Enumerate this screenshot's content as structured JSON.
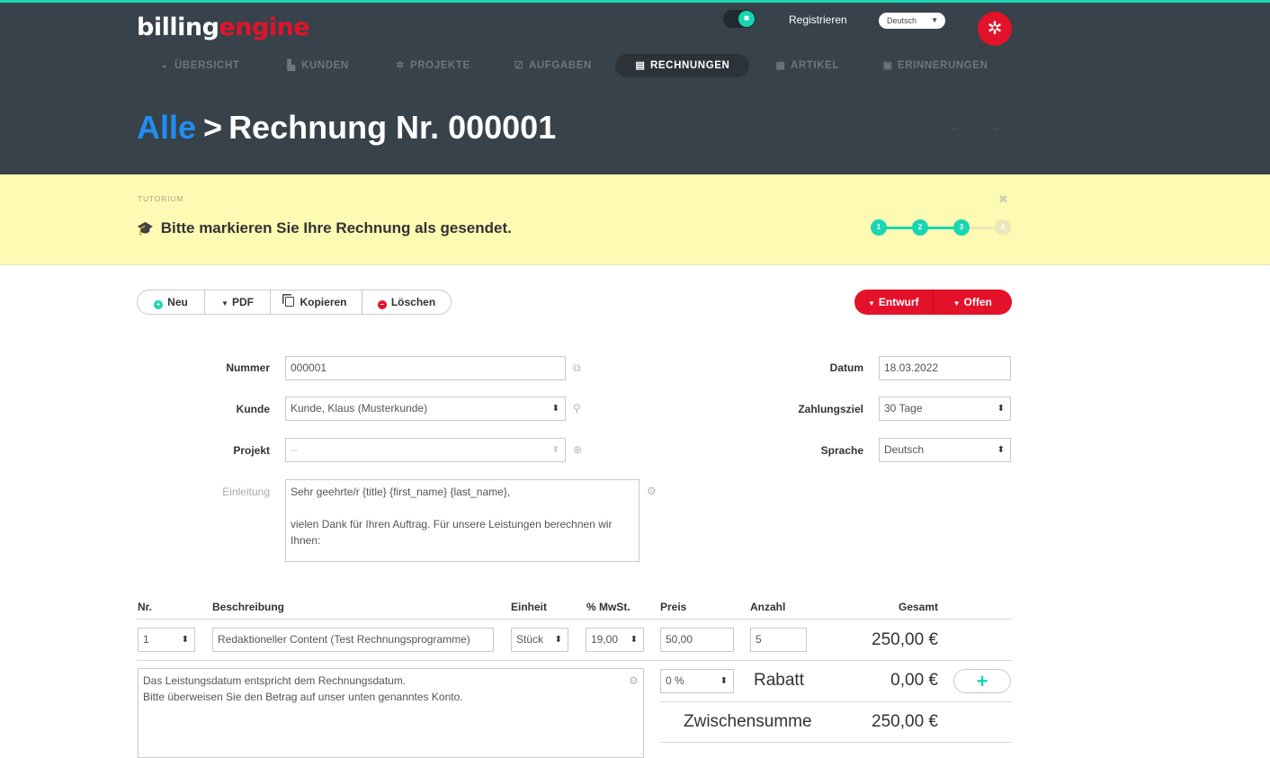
{
  "brand": {
    "logo_part1": "billing",
    "logo_part2": "engine"
  },
  "topbar": {
    "register": "Registrieren",
    "language": "Deutsch"
  },
  "nav": [
    {
      "label": "ÜBERSICHT",
      "icon": "dashboard-icon",
      "glyph": "◒"
    },
    {
      "label": "KUNDEN",
      "icon": "customers-icon",
      "glyph": "▙"
    },
    {
      "label": "PROJEKTE",
      "icon": "gear-icon",
      "glyph": "✲"
    },
    {
      "label": "AUFGABEN",
      "icon": "checkbox-icon",
      "glyph": "☑"
    },
    {
      "label": "RECHNUNGEN",
      "icon": "invoice-icon",
      "glyph": "▤"
    },
    {
      "label": "ARTIKEL",
      "icon": "article-icon",
      "glyph": "▦"
    },
    {
      "label": "ERINNERUNGEN",
      "icon": "calendar-icon",
      "glyph": "▣"
    }
  ],
  "page": {
    "crumb": "Alle",
    "title": "Rechnung Nr. 000001"
  },
  "tutorial": {
    "label": "TUTORIUM",
    "text": "Bitte markieren Sie Ihre Rechnung als gesendet.",
    "steps": [
      "1",
      "2",
      "3",
      "4"
    ],
    "current_step": 3
  },
  "toolbar": {
    "new": "Neu",
    "pdf": "PDF",
    "copy": "Kopieren",
    "delete": "Löschen"
  },
  "status": {
    "draft": "Entwurf",
    "open": "Offen"
  },
  "form": {
    "number_label": "Nummer",
    "number": "000001",
    "customer_label": "Kunde",
    "customer": "Kunde, Klaus (Musterkunde)",
    "project_label": "Projekt",
    "project": "--",
    "intro_label": "Einleitung",
    "intro_line1": "Sehr geehrte/r {title} {first_name} {last_name},",
    "intro_line2": "vielen Dank für Ihren Auftrag. Für unsere Leistungen berechnen wir",
    "intro_line3": "Ihnen:",
    "date_label": "Datum",
    "date": "18.03.2022",
    "payment_label": "Zahlungsziel",
    "payment": "30 Tage",
    "language_label": "Sprache",
    "language": "Deutsch"
  },
  "table": {
    "headers": {
      "nr": "Nr.",
      "desc": "Beschreibung",
      "unit": "Einheit",
      "vat": "% MwSt.",
      "price": "Preis",
      "qty": "Anzahl",
      "total": "Gesamt"
    },
    "rows": [
      {
        "nr": "1",
        "desc": "Redaktioneller Content (Test Rechnungsprogramme)",
        "unit": "Stück",
        "vat": "19,00",
        "price": "50,00",
        "qty": "5",
        "total": "250,00 €"
      }
    ]
  },
  "footer": {
    "note_line1": "Das Leistungsdatum entspricht dem Rechnungsdatum.",
    "note_line2": "Bitte überweisen Sie den Betrag auf unser unten genanntes Konto.",
    "discount": "0 %",
    "discount_label": "Rabatt",
    "discount_value": "0,00 €",
    "add": "+",
    "subtotal_label": "Zwischensumme",
    "subtotal": "250,00 €"
  },
  "colors": {
    "accent": "#18d6b3",
    "brand_red": "#e3122a",
    "link_blue": "#1f8ef1",
    "header_bg": "#38424a",
    "tutorial_bg": "#fdfab3"
  }
}
